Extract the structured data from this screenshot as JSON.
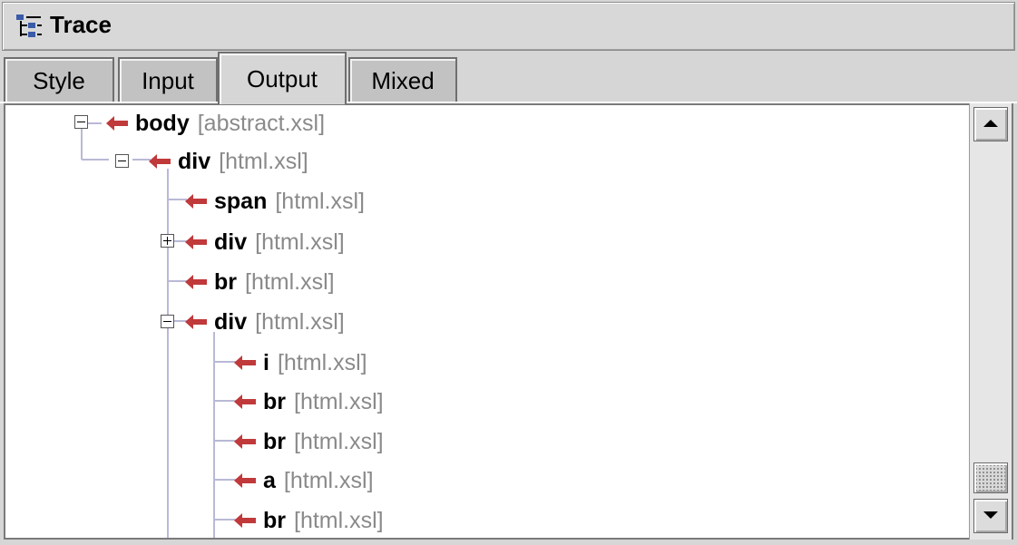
{
  "window": {
    "title": "Trace",
    "icon": "trace-tree-icon"
  },
  "tabs": [
    {
      "label": "Style",
      "selected": false
    },
    {
      "label": "Input",
      "selected": false
    },
    {
      "label": "Output",
      "selected": true
    },
    {
      "label": "Mixed",
      "selected": false
    }
  ],
  "tree": {
    "nodes": [
      {
        "tag": "body",
        "source": "[abstract.xsl]",
        "expander": "collapse"
      },
      {
        "tag": "div",
        "source": "[html.xsl]",
        "expander": "collapse"
      },
      {
        "tag": "span",
        "source": "[html.xsl]",
        "expander": null
      },
      {
        "tag": "div",
        "source": "[html.xsl]",
        "expander": "expand"
      },
      {
        "tag": "br",
        "source": "[html.xsl]",
        "expander": null
      },
      {
        "tag": "div",
        "source": "[html.xsl]",
        "expander": "collapse"
      },
      {
        "tag": "i",
        "source": "[html.xsl]",
        "expander": null
      },
      {
        "tag": "br",
        "source": "[html.xsl]",
        "expander": null
      },
      {
        "tag": "br",
        "source": "[html.xsl]",
        "expander": null
      },
      {
        "tag": "a",
        "source": "[html.xsl]",
        "expander": null
      },
      {
        "tag": "br",
        "source": "[html.xsl]",
        "expander": null
      }
    ],
    "arrow_icon": "red-left-arrow-icon",
    "colors": {
      "arrow": "#c0393b",
      "source_text": "#8a8a8a",
      "connector": "#b9b9d6"
    }
  },
  "scrollbar": {
    "up_icon": "scroll-up-arrow-icon",
    "down_icon": "scroll-down-arrow-icon"
  }
}
